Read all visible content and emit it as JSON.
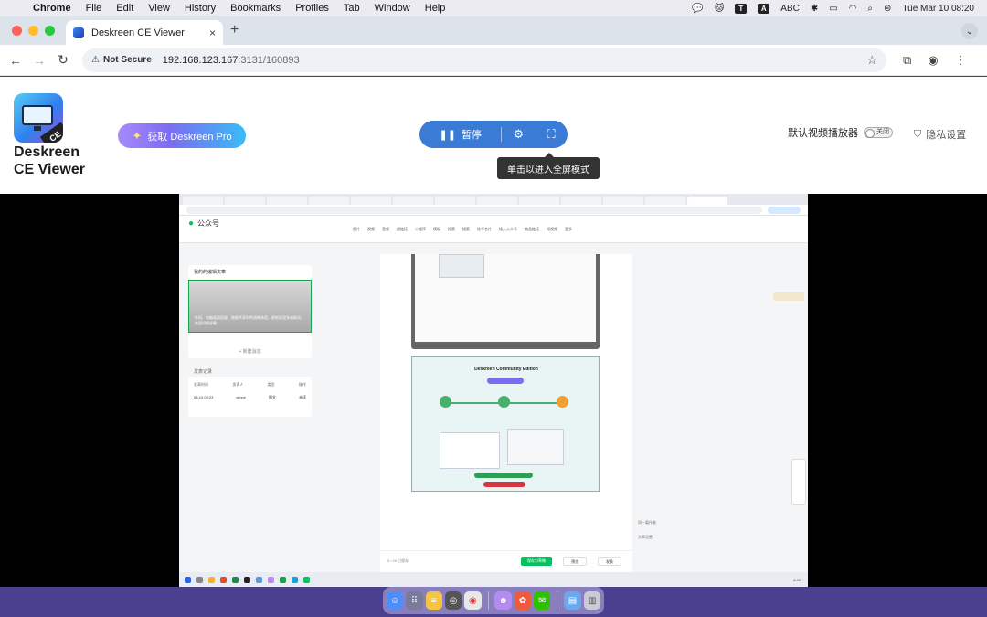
{
  "menubar": {
    "app": "Chrome",
    "items": [
      "File",
      "Edit",
      "View",
      "History",
      "Bookmarks",
      "Profiles",
      "Tab",
      "Window",
      "Help"
    ],
    "input_label": "ABC",
    "datetime": "Tue Mar 10  08:20"
  },
  "browser": {
    "tab_title": "Deskreen CE Viewer",
    "tab_close": "×",
    "new_tab": "+",
    "security_label": "Not Secure",
    "url_host": "192.168.123.167",
    "url_rest": ":3131/160893"
  },
  "app": {
    "name_line1": "Deskreen",
    "name_line2": "CE Viewer",
    "logo_badge": "CE",
    "pro_button": "获取 Deskreen Pro",
    "pause_label": "暂停",
    "tooltip": "单击以进入全屏模式",
    "player_label": "默认视频播放器",
    "player_toggle": "关闭",
    "privacy_label": "隐私设置",
    "accent_color": "#3a7bd5"
  },
  "remote": {
    "account": "公众号",
    "menu": [
      "图片",
      "视频",
      "音频",
      "超链接",
      "小程序",
      "模板",
      "投票",
      "搜索",
      "账号名片",
      "插入公众号",
      "商品链接",
      "短视频",
      "更多"
    ],
    "draft_card_title": "我的的编辑文章",
    "draft_thumb_text": "外机、电脑画面投屏、跨屏共享时的流畅体验，即刻实现多机联动，快速切换屏幕",
    "add_content": "+ 新建消息",
    "info_label": "发表记录",
    "info_cols": [
      "发表时间",
      "发表人",
      "类型",
      "操作"
    ],
    "info_row": [
      "03-10 08:23",
      "winne",
      "图文",
      "未读"
    ],
    "editor_title": "Deskreen Community Edition",
    "bottom_left": "0 / 20  已保存",
    "save_button": "保存为草稿",
    "preview_button": "预览",
    "publish_button": "发表",
    "side_items": [
      "同一篇作者",
      "文章设置"
    ],
    "clock": "8:20"
  }
}
